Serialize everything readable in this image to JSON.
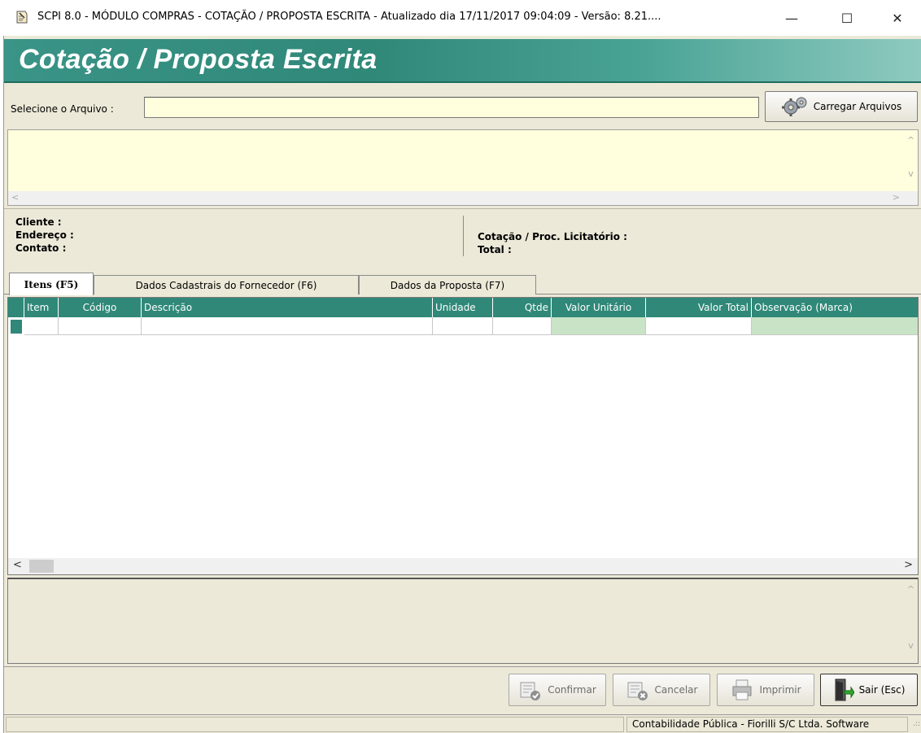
{
  "window": {
    "title": "SCPI 8.0 - MÓDULO COMPRAS - COTAÇÃO / PROPOSTA ESCRITA - Atualizado dia 17/11/2017 09:04:09 - Versão: 8.21....",
    "minimize": "—",
    "maximize": "☐",
    "close": "✕"
  },
  "banner": {
    "heading": "Cotação / Proposta Escrita"
  },
  "file": {
    "label": "Selecione o Arquivo :",
    "value": "",
    "load_button": "Carregar Arquivos"
  },
  "memo": {
    "up": "^",
    "down": "v",
    "left": "<",
    "right": ">"
  },
  "info": {
    "client": "Cliente :",
    "address": "Endereço :",
    "contact": "Contato :",
    "quotation": "Cotação / Proc. Licitatório :",
    "total": "Total :"
  },
  "tabs": [
    {
      "label": "Itens (F5)"
    },
    {
      "label": "Dados Cadastrais do Fornecedor (F6)"
    },
    {
      "label": "Dados da Proposta (F7)"
    }
  ],
  "grid": {
    "columns": [
      {
        "label": "Item"
      },
      {
        "label": "Código"
      },
      {
        "label": "Descrição"
      },
      {
        "label": "Unidade"
      },
      {
        "label": "Qtde"
      },
      {
        "label": "Valor Unitário"
      },
      {
        "label": "Valor Total"
      },
      {
        "label": "Observação (Marca)"
      }
    ],
    "scroll_left": "<",
    "scroll_right": ">"
  },
  "note": {
    "up": "^",
    "down": "v"
  },
  "buttons": {
    "confirm": "Confirmar",
    "cancel": "Cancelar",
    "print": "Imprimir",
    "exit": "Sair (Esc)"
  },
  "status": {
    "company": "Contabilidade Pública - Fiorilli S/C Ltda. Software"
  },
  "colors": {
    "accent": "#2f8878",
    "input_bg": "#ffffde",
    "form_bg": "#ece9d8",
    "grid_edit": "#c8e3c5"
  }
}
